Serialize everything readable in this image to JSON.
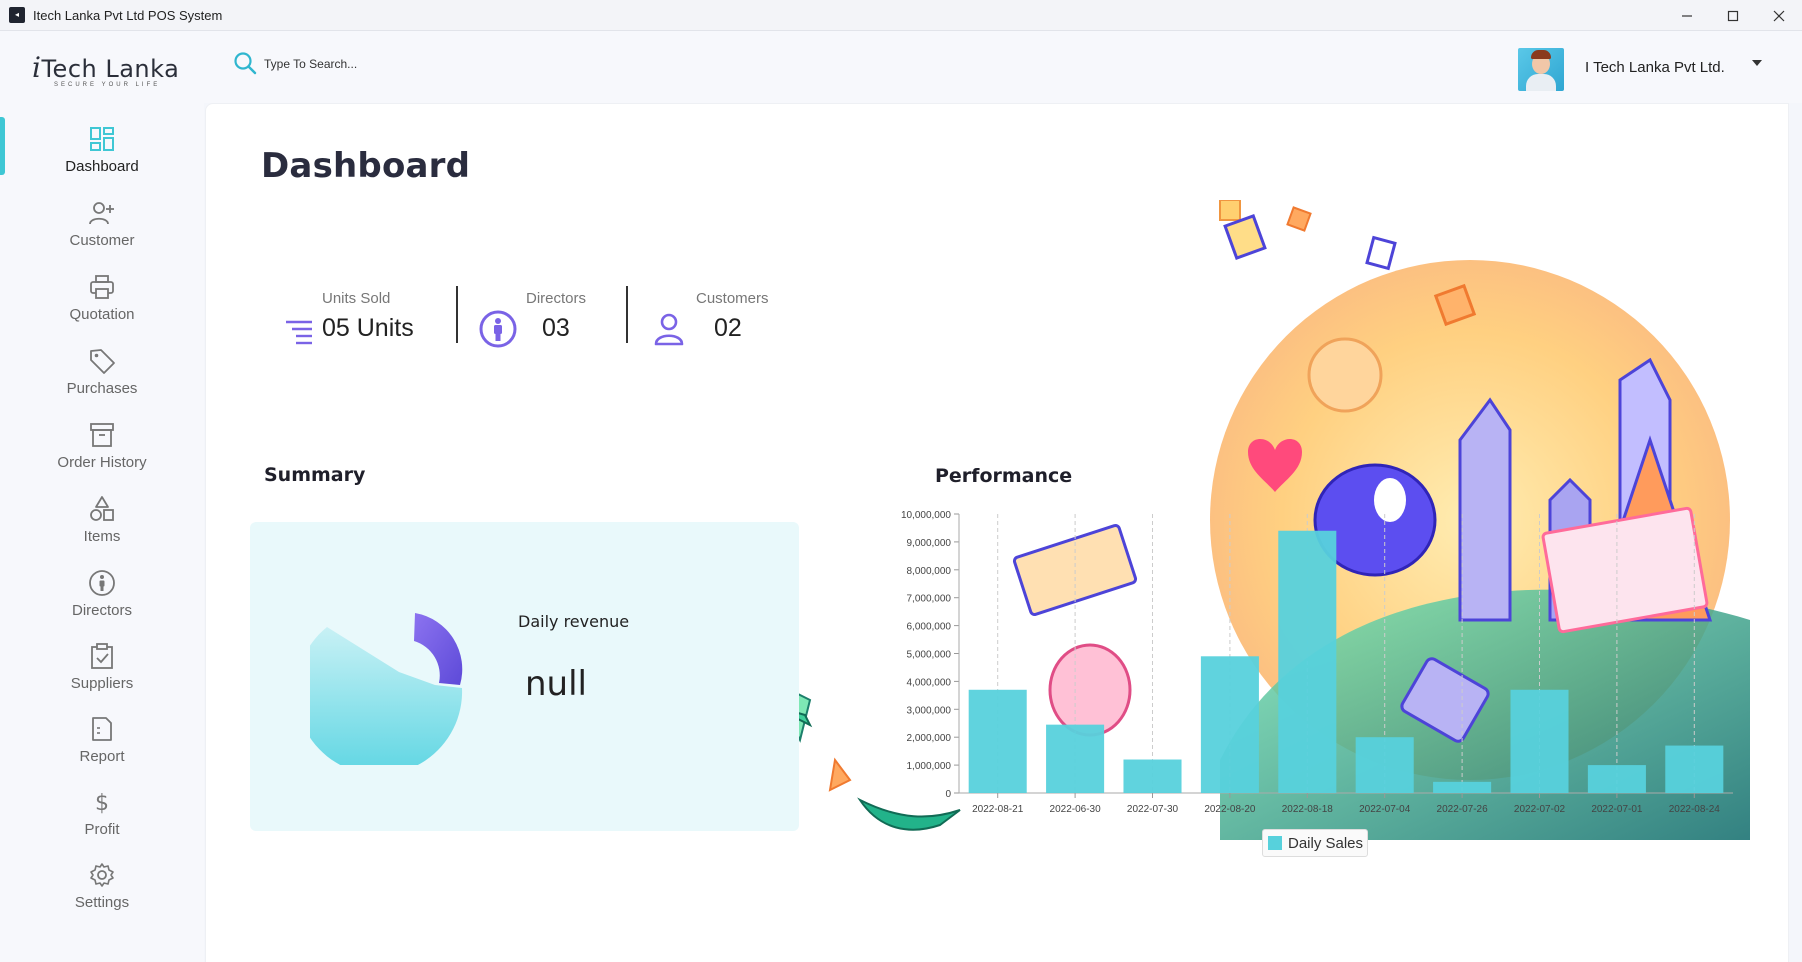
{
  "window": {
    "title": "Itech Lanka Pvt Ltd POS System",
    "controls": [
      "minimize-icon",
      "maximize-icon",
      "close-icon"
    ]
  },
  "brand": {
    "logo_text": "Tech Lanka",
    "logo_prefix": "i",
    "tagline": "SECURE YOUR LIFE"
  },
  "search": {
    "placeholder": "Type To Search..."
  },
  "user": {
    "company": "I Tech Lanka Pvt Ltd."
  },
  "sidebar": {
    "items": [
      {
        "label": "Dashboard",
        "icon": "grid-icon",
        "active": true
      },
      {
        "label": "Customer",
        "icon": "add-user-icon"
      },
      {
        "label": "Quotation",
        "icon": "printer-icon"
      },
      {
        "label": "Purchases",
        "icon": "tag-icon"
      },
      {
        "label": "Order History",
        "icon": "archive-icon"
      },
      {
        "label": "Items",
        "icon": "shapes-icon"
      },
      {
        "label": "Directors",
        "icon": "info-person-icon"
      },
      {
        "label": "Suppliers",
        "icon": "clipboard-check-icon"
      },
      {
        "label": "Report",
        "icon": "document-icon"
      },
      {
        "label": "Profit",
        "icon": "dollar-icon"
      },
      {
        "label": "Settings",
        "icon": "gear-icon"
      }
    ]
  },
  "page": {
    "title": "Dashboard"
  },
  "stats": [
    {
      "label": "Units Sold",
      "value": "05 Units",
      "icon": "list-icon"
    },
    {
      "label": "Directors",
      "value": "03",
      "icon": "info-person-icon"
    },
    {
      "label": "Customers",
      "value": "02",
      "icon": "person-icon"
    }
  ],
  "summary": {
    "title": "Summary",
    "revenue_label": "Daily revenue",
    "revenue_value": "null"
  },
  "performance": {
    "title": "Performance"
  },
  "colors": {
    "accent": "#3fc7d4",
    "bar": "#57d1dc",
    "stat_icon": "#7a63e6",
    "summary_bg": "#e9f9fb"
  },
  "chart_data": {
    "type": "bar",
    "categories": [
      "2022-08-21",
      "2022-06-30",
      "2022-07-30",
      "2022-08-20",
      "2022-08-18",
      "2022-07-04",
      "2022-07-26",
      "2022-07-02",
      "2022-07-01",
      "2022-08-24"
    ],
    "series": [
      {
        "name": "Daily Sales",
        "values": [
          3700000,
          2450000,
          1200000,
          4900000,
          9400000,
          2000000,
          400000,
          3700000,
          1000000,
          1700000
        ]
      }
    ],
    "yticks": [
      "0",
      "1,000,000",
      "2,000,000",
      "3,000,000",
      "4,000,000",
      "5,000,000",
      "6,000,000",
      "7,000,000",
      "8,000,000",
      "9,000,000",
      "10,000,000"
    ],
    "ylim": [
      0,
      10000000
    ],
    "legend": "bottom",
    "grid": "vertical-dashed"
  }
}
